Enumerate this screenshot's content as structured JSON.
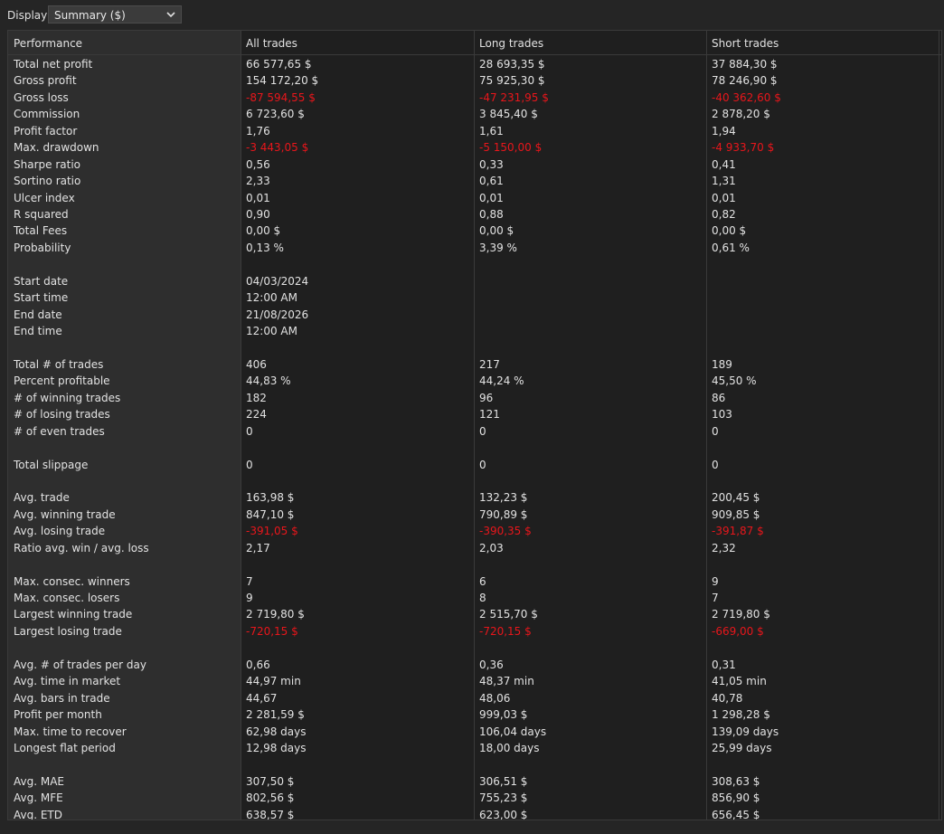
{
  "toolbar": {
    "display_label": "Display",
    "display_select_value": "Summary ($)"
  },
  "table": {
    "headers": [
      "Performance",
      "All trades",
      "Long trades",
      "Short trades"
    ],
    "negative_color": "#e8161b",
    "rows": [
      {
        "label": "Total net profit",
        "all": "66 577,65 $",
        "long": "28 693,35 $",
        "short": "37 884,30 $"
      },
      {
        "label": "Gross profit",
        "all": "154 172,20 $",
        "long": "75 925,30 $",
        "short": "78 246,90 $"
      },
      {
        "label": "Gross loss",
        "all": "-87 594,55 $",
        "long": "-47 231,95 $",
        "short": "-40 362,60 $",
        "negative": true
      },
      {
        "label": "Commission",
        "all": "6 723,60 $",
        "long": "3 845,40 $",
        "short": "2 878,20 $"
      },
      {
        "label": "Profit factor",
        "all": "1,76",
        "long": "1,61",
        "short": "1,94"
      },
      {
        "label": "Max. drawdown",
        "all": "-3 443,05 $",
        "long": "-5 150,00 $",
        "short": "-4 933,70 $",
        "negative": true
      },
      {
        "label": "Sharpe ratio",
        "all": "0,56",
        "long": "0,33",
        "short": "0,41"
      },
      {
        "label": "Sortino ratio",
        "all": "2,33",
        "long": "0,61",
        "short": "1,31"
      },
      {
        "label": "Ulcer index",
        "all": "0,01",
        "long": "0,01",
        "short": "0,01"
      },
      {
        "label": "R squared",
        "all": "0,90",
        "long": "0,88",
        "short": "0,82"
      },
      {
        "label": "Total Fees",
        "all": "0,00 $",
        "long": "0,00 $",
        "short": "0,00 $"
      },
      {
        "label": "Probability",
        "all": "0,13 %",
        "long": "3,39 %",
        "short": "0,61 %"
      },
      {
        "label": "",
        "all": "",
        "long": "",
        "short": ""
      },
      {
        "label": "Start date",
        "all": "04/03/2024",
        "long": "",
        "short": ""
      },
      {
        "label": "Start time",
        "all": "12:00 AM",
        "long": "",
        "short": ""
      },
      {
        "label": "End date",
        "all": "21/08/2026",
        "long": "",
        "short": ""
      },
      {
        "label": "End time",
        "all": "12:00 AM",
        "long": "",
        "short": ""
      },
      {
        "label": "",
        "all": "",
        "long": "",
        "short": ""
      },
      {
        "label": "Total # of trades",
        "all": "406",
        "long": "217",
        "short": "189"
      },
      {
        "label": "Percent profitable",
        "all": "44,83 %",
        "long": "44,24 %",
        "short": "45,50 %"
      },
      {
        "label": "# of winning trades",
        "all": "182",
        "long": "96",
        "short": "86"
      },
      {
        "label": "# of losing trades",
        "all": "224",
        "long": "121",
        "short": "103"
      },
      {
        "label": "# of even trades",
        "all": "0",
        "long": "0",
        "short": "0"
      },
      {
        "label": "",
        "all": "",
        "long": "",
        "short": ""
      },
      {
        "label": "Total slippage",
        "all": "0",
        "long": "0",
        "short": "0"
      },
      {
        "label": "",
        "all": "",
        "long": "",
        "short": ""
      },
      {
        "label": "Avg. trade",
        "all": "163,98 $",
        "long": "132,23 $",
        "short": "200,45 $"
      },
      {
        "label": "Avg. winning trade",
        "all": "847,10 $",
        "long": "790,89 $",
        "short": "909,85 $"
      },
      {
        "label": "Avg. losing trade",
        "all": "-391,05 $",
        "long": "-390,35 $",
        "short": "-391,87 $",
        "negative": true
      },
      {
        "label": "Ratio avg. win / avg. loss",
        "all": "2,17",
        "long": "2,03",
        "short": "2,32"
      },
      {
        "label": "",
        "all": "",
        "long": "",
        "short": ""
      },
      {
        "label": "Max. consec. winners",
        "all": "7",
        "long": "6",
        "short": "9"
      },
      {
        "label": "Max. consec. losers",
        "all": "9",
        "long": "8",
        "short": "7"
      },
      {
        "label": "Largest winning trade",
        "all": "2 719,80 $",
        "long": "2 515,70 $",
        "short": "2 719,80 $"
      },
      {
        "label": "Largest losing trade",
        "all": "-720,15 $",
        "long": "-720,15 $",
        "short": "-669,00 $",
        "negative": true
      },
      {
        "label": "",
        "all": "",
        "long": "",
        "short": ""
      },
      {
        "label": "Avg. # of trades per day",
        "all": "0,66",
        "long": "0,36",
        "short": "0,31"
      },
      {
        "label": "Avg. time in market",
        "all": "44,97 min",
        "long": "48,37 min",
        "short": "41,05 min"
      },
      {
        "label": "Avg. bars in trade",
        "all": "44,67",
        "long": "48,06",
        "short": "40,78"
      },
      {
        "label": "Profit per month",
        "all": "2 281,59 $",
        "long": "999,03 $",
        "short": "1 298,28 $"
      },
      {
        "label": "Max. time to recover",
        "all": "62,98 days",
        "long": "106,04 days",
        "short": "139,09 days"
      },
      {
        "label": "Longest flat period",
        "all": "12,98 days",
        "long": "18,00 days",
        "short": "25,99 days"
      },
      {
        "label": "",
        "all": "",
        "long": "",
        "short": ""
      },
      {
        "label": "Avg. MAE",
        "all": "307,50 $",
        "long": "306,51 $",
        "short": "308,63 $"
      },
      {
        "label": "Avg. MFE",
        "all": "802,56 $",
        "long": "755,23 $",
        "short": "856,90 $"
      },
      {
        "label": "Avg. ETD",
        "all": "638,57 $",
        "long": "623,00 $",
        "short": "656,45 $"
      }
    ]
  }
}
